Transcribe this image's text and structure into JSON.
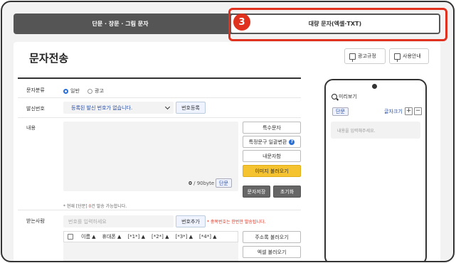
{
  "tabs": {
    "left_label": "단문 · 장문 · 그림 문자",
    "right_label": "대량 문자(엑셀·TXT)",
    "step_number": "3"
  },
  "header": {
    "title": "문자전송",
    "ad_rules_label": "광고규정",
    "usage_label": "사용안내"
  },
  "form": {
    "type_label": "문자분류",
    "type_options": [
      "일반",
      "광고"
    ],
    "type_selected": "일반",
    "sender_label": "발신번호",
    "sender_value": "등록된 발신 번호가 없습니다.",
    "register_number_label": "번호등록",
    "content_label": "내용",
    "counter_value": "0",
    "counter_limit": "/ 90byte",
    "sms_chip": "단문",
    "side_buttons": {
      "special_chars": "특수문자",
      "bulk_replace": "특정문구 일괄변환",
      "my_messages": "내문자함",
      "load_image": "이미지 불러오기",
      "save_message": "문자저장",
      "reset": "초기화"
    },
    "note_prefix": "* 현재 [단문] ",
    "note_count": "0",
    "note_suffix": "건 발송 가능합니다.",
    "recipient_label": "받는사람",
    "recipient_placeholder": "번호를 입력하세요",
    "add_number_label": "번호추가",
    "dup_note": "* 중복번호는 한번만 발송됩니다.",
    "table_headers": [
      "이름 ▲",
      "휴대폰 ▲",
      "[*1*] ▲",
      "[*2*] ▲",
      "[*3*] ▲",
      "[*4*] ▲"
    ],
    "load_address_book": "주소록 불러오기",
    "load_excel": "엑셀 불러오기"
  },
  "preview": {
    "title": "미리보기",
    "chip": "단문",
    "font_size_label": "글자크기",
    "plus": "+",
    "minus": "−",
    "placeholder": "내용을 입력해주세요."
  },
  "colors": {
    "accent_red": "#e0301e",
    "primary_blue": "#2a6fd6",
    "yellow": "#f5c230"
  }
}
